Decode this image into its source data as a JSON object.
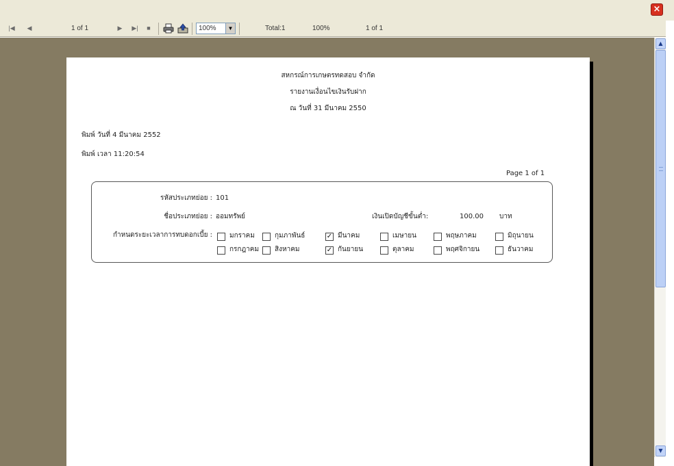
{
  "window": {
    "close_glyph": "×"
  },
  "toolbar": {
    "first_icon": "|◀",
    "prev_icon": "◀",
    "page_indicator": "1 of 1",
    "next_icon": "▶",
    "last_icon": "▶|",
    "stop_icon": "■",
    "zoom_value": "100%",
    "zoom_arrow": "▼",
    "total_label": "Total:1",
    "zoom_percent": "100%",
    "page_status": "1 of 1"
  },
  "scrollbar": {
    "up": "▲",
    "down": "▼"
  },
  "report": {
    "org_name": "สหกรณ์การเกษตรทดสอบ จำกัด",
    "title": "รายงานเงื่อนไขเงินรับฝาก",
    "as_of": "ณ วันที่ 31 มีนาคม 2550",
    "print_date": "พิมพ์ วันที่ 4 มีนาคม 2552",
    "print_time": "พิมพ์ เวลา 11:20:54",
    "page_info": "Page 1 of 1",
    "fields": {
      "subtype_code_label": "รหัสประเภทย่อย :",
      "subtype_code_value": "101",
      "subtype_name_label": "ชื่อประเภทย่อย :",
      "subtype_name_value": "ออมทรัพย์",
      "min_open_label": "เงินเปิดบัญชีขั้นต่ำ:",
      "min_open_value": "100.00",
      "min_open_unit": "บาท",
      "interest_period_label": "กำหนดระยะเวลาการทบดอกเบี้ย :"
    },
    "months": [
      {
        "label": "มกราคม",
        "checked": false
      },
      {
        "label": "กุมภาพันธ์",
        "checked": false
      },
      {
        "label": "มีนาคม",
        "checked": true
      },
      {
        "label": "เมษายน",
        "checked": false
      },
      {
        "label": "พฤษภาคม",
        "checked": false
      },
      {
        "label": "มิถุนายน",
        "checked": false
      },
      {
        "label": "กรกฎาคม",
        "checked": false
      },
      {
        "label": "สิงหาคม",
        "checked": false
      },
      {
        "label": "กันยายน",
        "checked": true
      },
      {
        "label": "ตุลาคม",
        "checked": false
      },
      {
        "label": "พฤศจิกายน",
        "checked": false
      },
      {
        "label": "ธันวาคม",
        "checked": false
      }
    ],
    "check_glyph": "✓"
  }
}
